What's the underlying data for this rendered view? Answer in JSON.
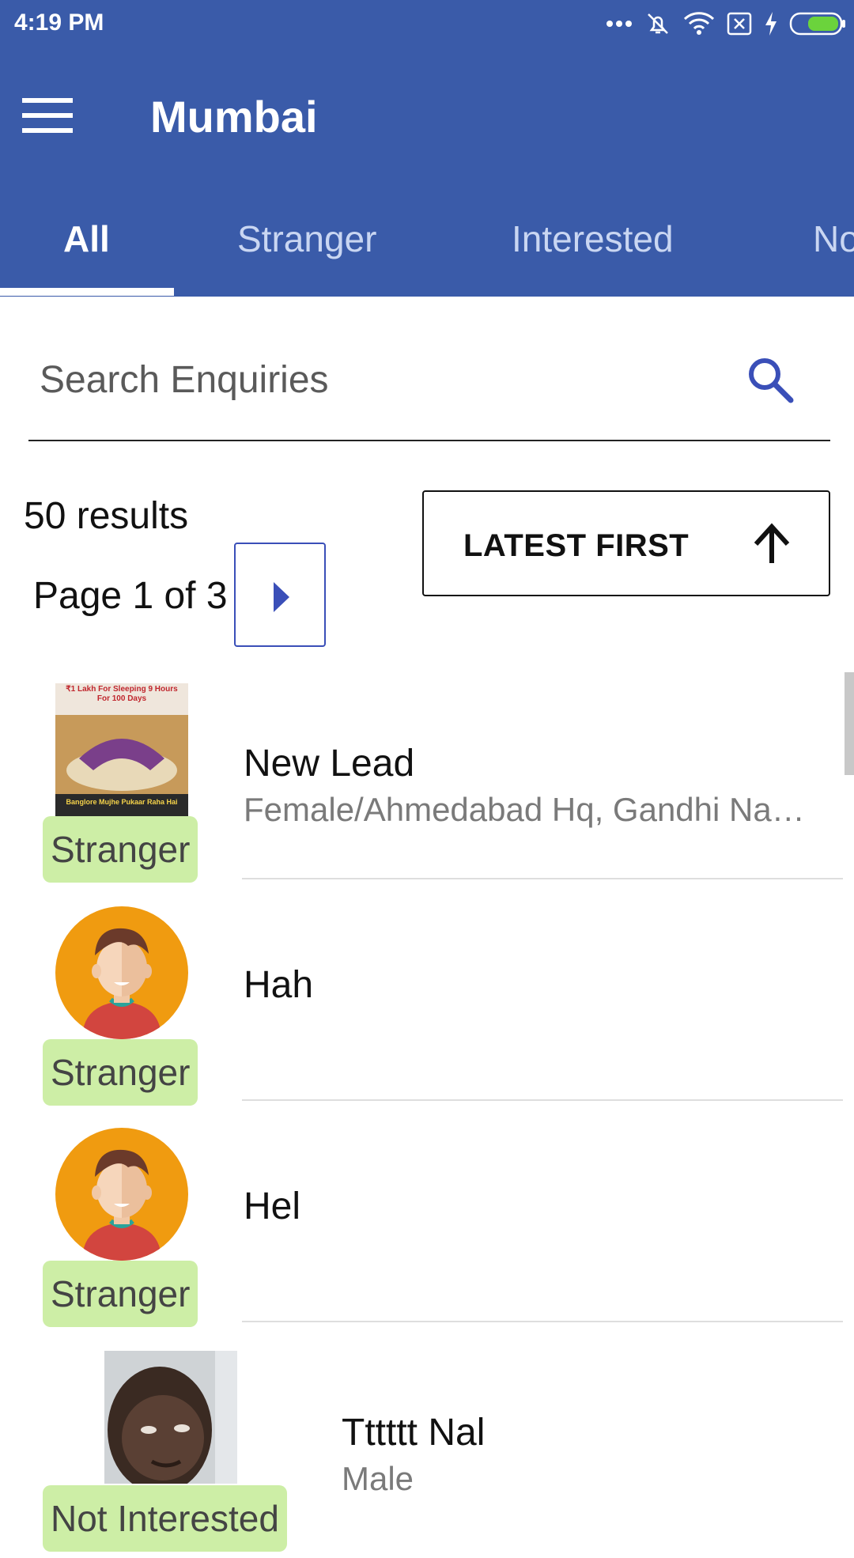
{
  "status_bar": {
    "time": "4:19 PM"
  },
  "header": {
    "title": "Mumbai"
  },
  "tabs": [
    {
      "label": "All",
      "active": true
    },
    {
      "label": "Stranger",
      "active": false
    },
    {
      "label": "Interested",
      "active": false
    },
    {
      "label": "No",
      "active": false
    }
  ],
  "search": {
    "placeholder": "Search Enquiries",
    "value": ""
  },
  "results": {
    "count_text": "50 results",
    "page_text": "Page 1 of 3"
  },
  "sort": {
    "label": "LATEST FIRST"
  },
  "enquiries": [
    {
      "name": "New Lead",
      "subtitle": "Female/Ahmedabad Hq, Gandhi Nag...",
      "status": "Stranger",
      "thumbnail": "poster-image",
      "thumbnail_text_top": "₹1 Lakh For Sleeping 9 Hours For 100 Days",
      "thumbnail_text_bottom": "Banglore Mujhe Pukaar Raha Hai"
    },
    {
      "name": "Hah",
      "subtitle": "",
      "status": "Stranger",
      "thumbnail": "avatar-illustration"
    },
    {
      "name": "Hel",
      "subtitle": "",
      "status": "Stranger",
      "thumbnail": "avatar-illustration"
    },
    {
      "name": "Tttttt Nal",
      "subtitle": "Male",
      "status": "Not Interested",
      "thumbnail": "photo"
    }
  ],
  "colors": {
    "primary": "#3a5ba9",
    "badge_bg": "#cdeea6",
    "accent_icon": "#3a4fb8"
  }
}
